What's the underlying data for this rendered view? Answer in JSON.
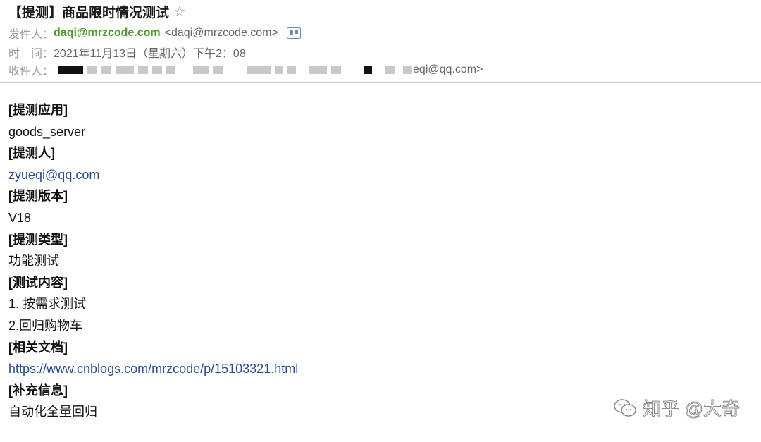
{
  "email": {
    "subject": "【提测】商品限时情况测试",
    "star_icon": "star-icon",
    "from_label": "发件人：",
    "sender_name": "daqi@mrzcode.com",
    "sender_address": "<daqi@mrzcode.com>",
    "contact_card_icon": "contact-card-icon",
    "time_label": "时　间：",
    "time_value": "2021年11月13日（星期六）下午2：08",
    "to_label": "收件人：",
    "recipients_visible_tail": "eqi@qq.com>"
  },
  "content": {
    "lines": [
      "[提测应用]",
      "goods_server",
      "[提测人]",
      "zyueqi@qq.com",
      "[提测版本]",
      "V18",
      "[提测类型]",
      "功能测试",
      "[测试内容]",
      "1. 按需求测试",
      "2.回归购物车",
      "[相关文档]",
      "https://www.cnblogs.com/mrzcode/p/15103321.html",
      "[补充信息]",
      "自动化全量回归"
    ]
  },
  "watermark": {
    "text": "知乎 @大奇",
    "icon": "wechat-icon"
  },
  "colors": {
    "sender_green": "#4f9a2a",
    "link_blue": "#2a4b8d",
    "divider": "#c8ccd4"
  }
}
